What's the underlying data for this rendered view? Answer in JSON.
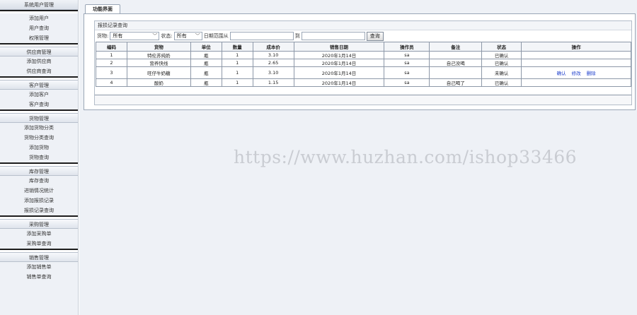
{
  "sidebar": {
    "groups": [
      {
        "header": "系统用户管理",
        "items": [
          "添加用户",
          "用户查询",
          "权限管理"
        ]
      },
      {
        "header": "供应商管理",
        "items": [
          "添加供应商",
          "供应商查询"
        ]
      },
      {
        "header": "客户管理",
        "items": [
          "添加客户",
          "客户查询"
        ]
      },
      {
        "header": "货物管理",
        "items": [
          "添加货物分类",
          "货物分类查询",
          "添加货物",
          "货物查询"
        ]
      },
      {
        "header": "库存管理",
        "items": [
          "库存查询",
          "进销情况统计",
          "添加报损记录",
          "报损记录查询"
        ]
      },
      {
        "header": "采购管理",
        "items": [
          "添加采购单",
          "采购单查询"
        ]
      },
      {
        "header": "销售管理",
        "items": [
          "添加销售单",
          "销售单查询"
        ]
      }
    ]
  },
  "tabs": [
    "功能界面"
  ],
  "panel": {
    "title": "报损记录查询",
    "filter": {
      "goods_label": "货物:",
      "goods_value": "所有",
      "status_label": "状态:",
      "status_value": "所有",
      "date_label": "日期范围从",
      "to_label": "到",
      "search_button": "查询"
    }
  },
  "table": {
    "headers": [
      "编码",
      "货物",
      "单位",
      "数量",
      "成本价",
      "销售日期",
      "操作员",
      "备注",
      "状态",
      "操作"
    ],
    "rows": [
      [
        "1",
        "特伦苏纯奶",
        "瓶",
        "1",
        "3.10",
        "2020年1月14日",
        "sa",
        "",
        "已确认",
        ""
      ],
      [
        "2",
        "营养快线",
        "瓶",
        "1",
        "2.65",
        "2020年1月14日",
        "sa",
        "自己没喝",
        "已确认",
        ""
      ],
      [
        "3",
        "旺仔牛奶糖",
        "瓶",
        "1",
        "3.10",
        "2020年1月14日",
        "sa",
        "",
        "未确认",
        ""
      ],
      [
        "4",
        "酸奶",
        "瓶",
        "1",
        "1.15",
        "2020年1月14日",
        "sa",
        "自己喝了",
        "已确认",
        ""
      ]
    ],
    "actions": [
      "确认",
      "修改",
      "删除"
    ]
  },
  "watermark": "https://www.huzhan.com/ishop33466"
}
